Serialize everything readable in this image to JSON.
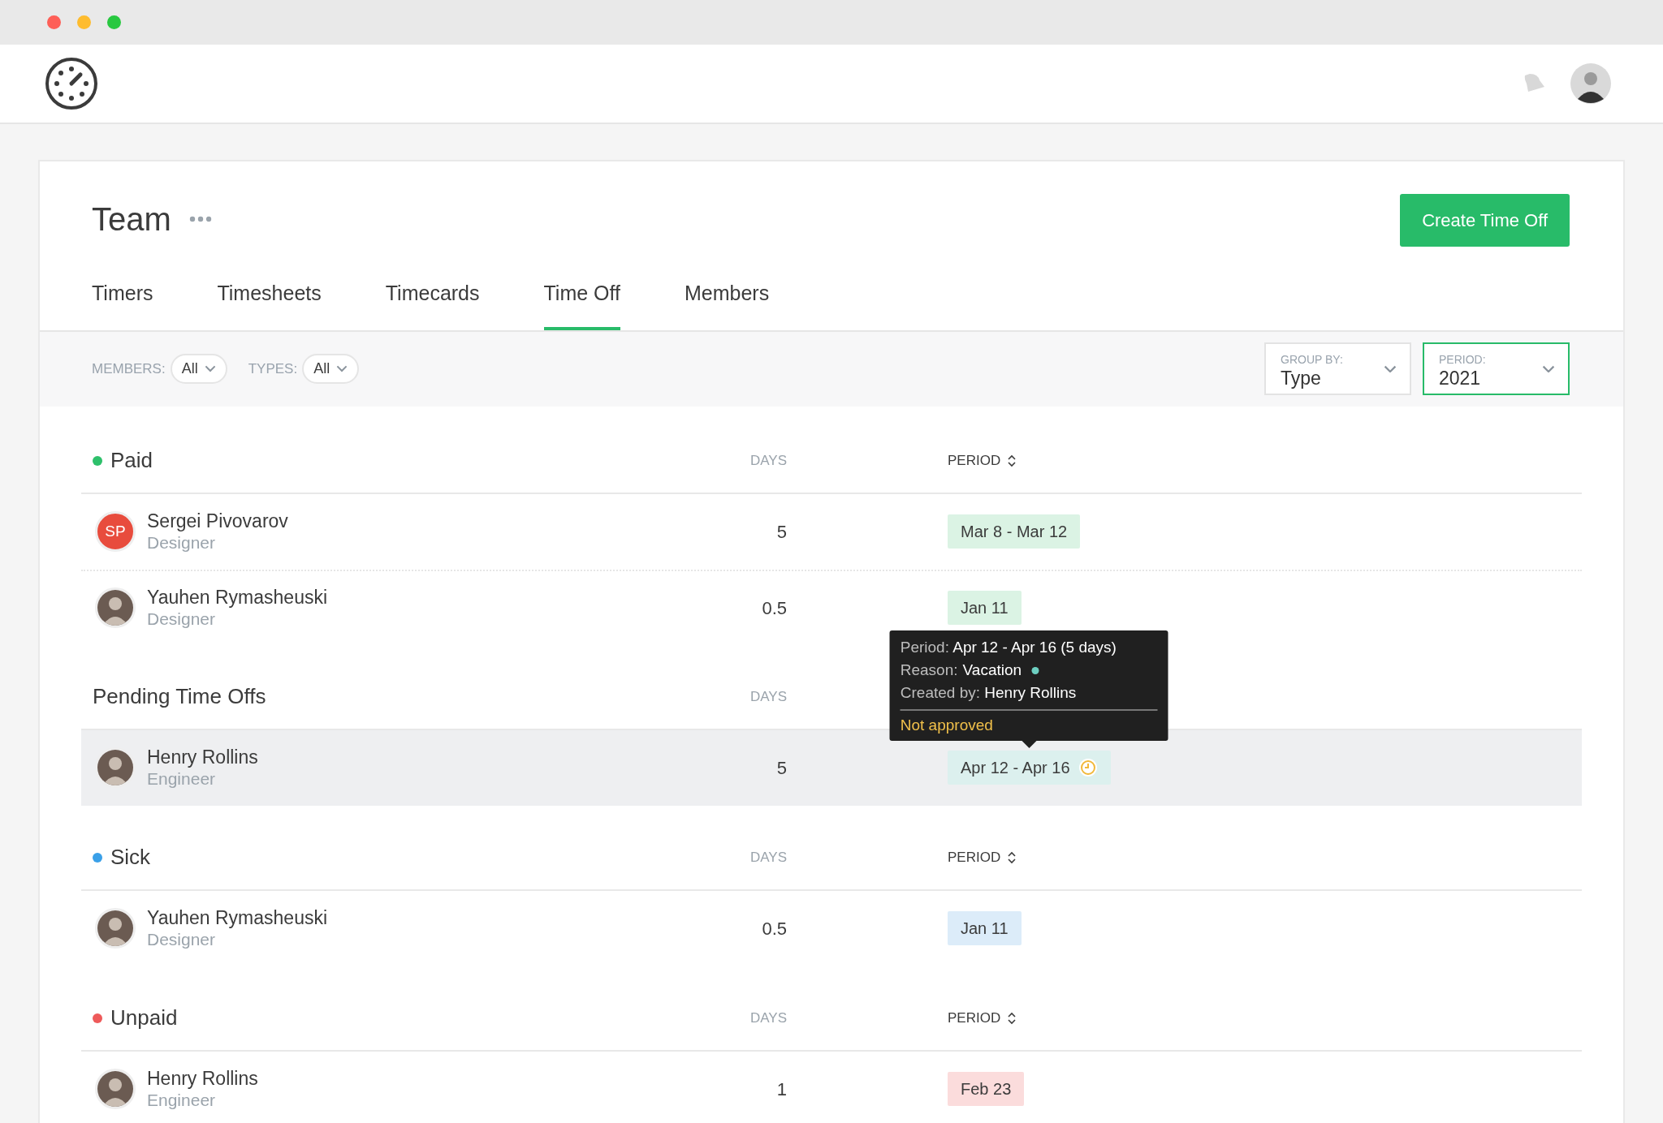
{
  "page": {
    "title": "Team",
    "primary_button": "Create Time Off"
  },
  "tabs": [
    {
      "label": "Timers",
      "selected": false
    },
    {
      "label": "Timesheets",
      "selected": false
    },
    {
      "label": "Timecards",
      "selected": false
    },
    {
      "label": "Time Off",
      "selected": true
    },
    {
      "label": "Members",
      "selected": false
    }
  ],
  "filters": [
    {
      "label": "MEMBERS:",
      "value": "All"
    },
    {
      "label": "TYPES:",
      "value": "All"
    }
  ],
  "selects": [
    {
      "label": "GROUP BY:",
      "value": "Type",
      "focused": false
    },
    {
      "label": "PERIOD:",
      "value": "2021",
      "focused": true
    }
  ],
  "sections": [
    {
      "title": "Paid",
      "color": "#2ec06b",
      "days_header": "DAYS",
      "period_header": "PERIOD",
      "rows": [
        {
          "name": "Sergei Pivovarov",
          "role": "Designer",
          "avatar": {
            "kind": "initials",
            "text": "SP"
          },
          "days": "5",
          "period": "Mar 8 - Mar 12",
          "color": "#dbf3e4",
          "pending": false,
          "highlighted": false
        },
        {
          "name": "Yauhen Rymasheuski",
          "role": "Designer",
          "avatar": {
            "kind": "photo"
          },
          "days": "0.5",
          "period": "Jan 11",
          "color": "#dbf3e4",
          "pending": false,
          "highlighted": false
        }
      ]
    },
    {
      "title": "Pending Time Offs",
      "days_header": "DAYS",
      "rows": [
        {
          "name": "Henry Rollins",
          "role": "Engineer",
          "avatar": {
            "kind": "photo"
          },
          "days": "5",
          "period": "Apr 12 - Apr 16",
          "color": "#dcf0ee",
          "pending": true,
          "highlighted": true,
          "tooltip": {
            "period_label": "Period:",
            "period": "Apr 12 - Apr 16 (5 days)",
            "reason_label": "Reason:",
            "reason": "Vacation",
            "color": "#6dcfc1",
            "created_label": "Created by:",
            "created_by": "Henry Rollins",
            "status": "Not approved"
          }
        }
      ]
    },
    {
      "title": "Sick",
      "color": "#3aa0e8",
      "days_header": "DAYS",
      "period_header": "PERIOD",
      "rows": [
        {
          "name": "Yauhen Rymasheuski",
          "role": "Designer",
          "avatar": {
            "kind": "photo"
          },
          "days": "0.5",
          "period": "Jan 11",
          "color": "#dcecf9",
          "pending": false,
          "highlighted": false
        }
      ]
    },
    {
      "title": "Unpaid",
      "color": "#ee5a5a",
      "days_header": "DAYS",
      "period_header": "PERIOD",
      "rows": [
        {
          "name": "Henry Rollins",
          "role": "Engineer",
          "avatar": {
            "kind": "photo"
          },
          "days": "1",
          "period": "Feb 23",
          "color": "#fbdcdc",
          "pending": false,
          "highlighted": false
        }
      ]
    }
  ]
}
